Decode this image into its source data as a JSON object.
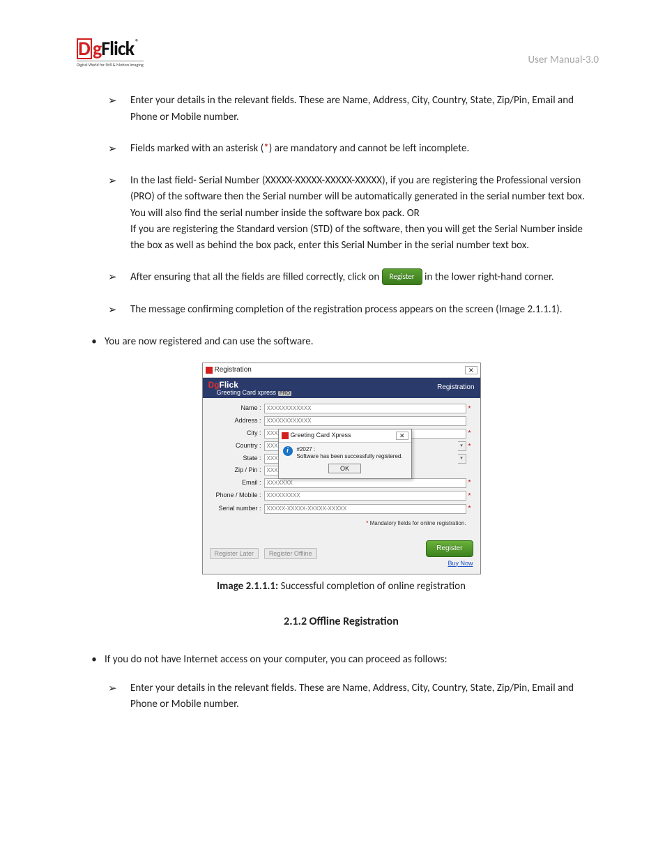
{
  "header": {
    "logo_letter": "D",
    "logo_rest_before_g": "",
    "logo_g": "g",
    "logo_after_g": "Flick",
    "logo_r": "®",
    "logo_tagline": "Digital World for Still & Motion Imaging",
    "right_text": "User Manual-3.0"
  },
  "bullets": {
    "b1": "Enter your details in the relevant fields. These are Name, Address, City, Country, State, Zip/Pin, Email and Phone or Mobile number.",
    "b2_pre": "Fields marked with an asterisk (",
    "b2_star": "*",
    "b2_post": ") are mandatory and cannot be left incomplete.",
    "b3_p1": "In the last field- Serial Number (XXXXX-XXXXX-XXXXX-XXXXX), if you are registering the Professional version (PRO) of the software then the Serial number will be automatically generated in the serial number text box. You will also find the serial number inside the software box pack. OR",
    "b3_p2": "If you are registering the Standard version (STD) of the software, then you will get the Serial Number inside the box as well as behind the box pack, enter this Serial Number in the serial number text box.",
    "b4_pre": "After ensuring that all the fields are filled correctly, click on ",
    "b4_btn": "Register",
    "b4_post": " in the lower right-hand corner.",
    "b5": "The message confirming completion of the registration process appears on the screen (Image 2.1.1.1)."
  },
  "outer1": "You are now registered and can use the software.",
  "caption_b": "Image 2.1.1.1:",
  "caption_t": " Successful completion of online registration",
  "section": "2.1.2 Offline Registration",
  "outer2": "If you do not have Internet access on your computer, you can proceed as follows:",
  "bullets2": {
    "b1": "Enter your details in the relevant fields. These are Name, Address, City, Country, State, Zip/Pin, Email and Phone or Mobile number."
  },
  "reg": {
    "titlebar": "Registration",
    "brand": "DgFlick",
    "subtitle": "Greeting Card xpress",
    "pro": "PRO",
    "heading": "Registration",
    "labels": {
      "name": "Name :",
      "address": "Address :",
      "city": "City :",
      "country": "Country :",
      "state": "State :",
      "zip": "Zip / Pin :",
      "email": "Email :",
      "phone": "Phone / Mobile :",
      "serial": "Serial number :"
    },
    "vals": {
      "name": "XXXXXXXXXXXX",
      "address": "XXXXXXXXXXXX",
      "city": "XXXXXXXXXXXX",
      "country": "XXXXXXX",
      "state": "XXXXXX",
      "zip": "XXXXXXXX",
      "email": "XXXXXXX",
      "phone": "XXXXXXXXX",
      "serial": "XXXXX-XXXXX-XXXXX-XXXXX"
    },
    "mandatory_note_star": "*",
    "mandatory_note": " Mandatory fields for online registration.",
    "register_btn": "Register",
    "register_later": "Register Later",
    "register_offline": "Register Offline",
    "buy_now": "Buy Now",
    "popup": {
      "title": "Greeting Card Xpress",
      "code": "#2027 :",
      "msg": "Software has been successfully registered.",
      "ok": "OK"
    }
  }
}
